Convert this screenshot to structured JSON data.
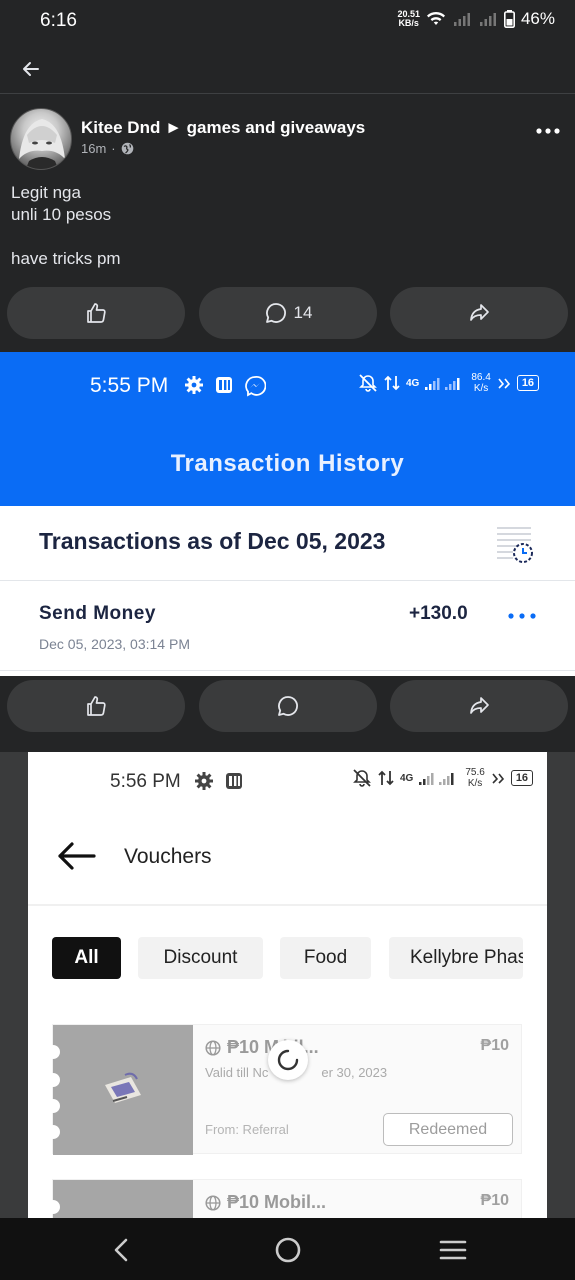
{
  "status_bar": {
    "time": "6:16",
    "speed_value": "20.51",
    "speed_unit": "KB/s",
    "battery": "46%"
  },
  "post": {
    "author": "Kitee Dnd",
    "group": "games and giveaways",
    "time_ago": "16m",
    "text_lines": [
      "Legit nga",
      "unli 10 pesos",
      "",
      "have tricks pm"
    ],
    "comment_count": "14"
  },
  "transaction_shot": {
    "time": "5:55 PM",
    "network": "4G",
    "speed_value": "86.4",
    "speed_unit": "K/s",
    "battery": "16",
    "header_title": "Transaction History",
    "heading": "Transactions as of Dec 05, 2023",
    "item_type": "Send Money",
    "item_date": "Dec 05, 2023, 03:14 PM",
    "item_amount": "+130.0",
    "accent_color": "#0a6cf5"
  },
  "voucher_shot": {
    "time": "5:56 PM",
    "network": "4G",
    "speed_value": "75.6",
    "speed_unit": "K/s",
    "battery": "16",
    "title": "Vouchers",
    "tabs": [
      "All",
      "Discount",
      "Food",
      "Kellybre Phas"
    ],
    "vouchers": [
      {
        "name": "₱10 M bil...",
        "price": "₱10",
        "valid": "Valid till Nc",
        "valid_end": "er 30, 2023",
        "from": "From: Referral",
        "button": "Redeemed"
      },
      {
        "name": "₱10 Mobil...",
        "price": "₱10"
      }
    ]
  },
  "icons": {
    "back": "arrow-left-icon",
    "more": "more-horizontal-icon",
    "like": "thumbs-up-icon",
    "comment": "comment-icon",
    "share": "share-icon",
    "globe": "globe-icon"
  }
}
